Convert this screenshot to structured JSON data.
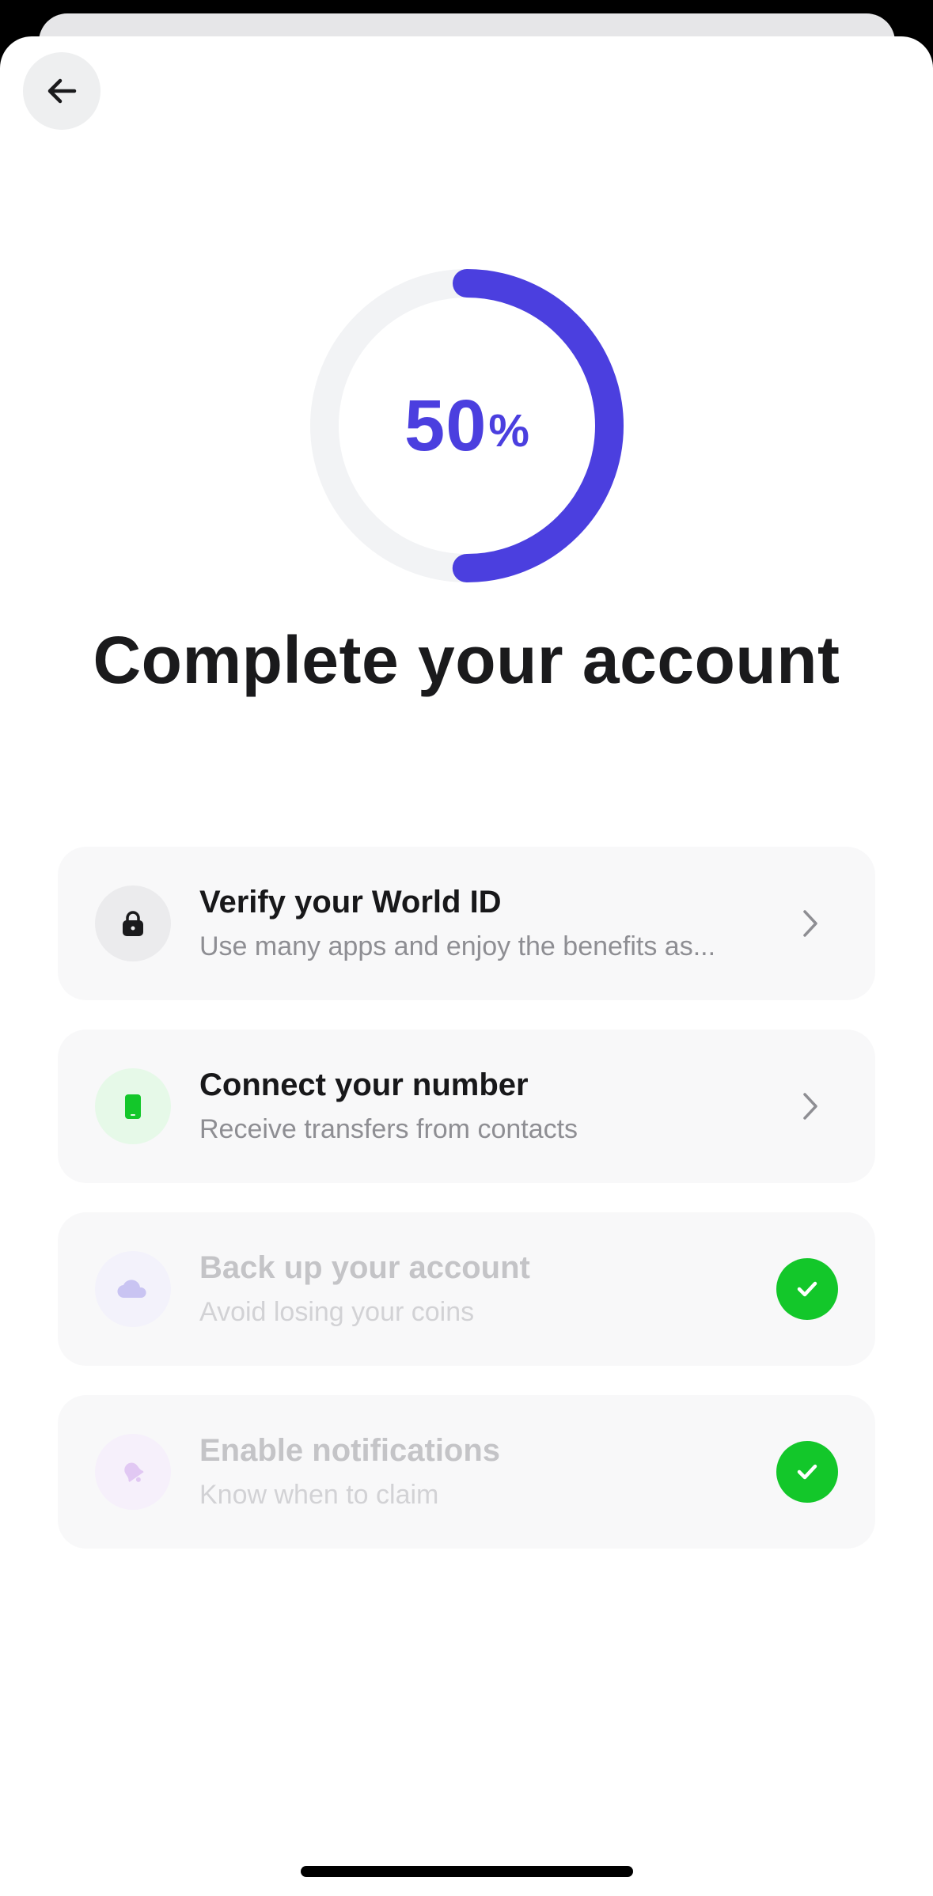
{
  "progress": {
    "value": 50,
    "number_text": "50",
    "unit_text": "%",
    "fraction": 0.5,
    "color": "#4b3fdf",
    "track_color": "#f2f3f5"
  },
  "header": {
    "back_icon": "arrow-left-icon"
  },
  "title": "Complete your account",
  "tasks": [
    {
      "title": "Verify your World ID",
      "subtitle": "Use many apps and enjoy the benefits as...",
      "icon": "lock-icon",
      "icon_bg": "#ebebed",
      "icon_color": "#1a1a1c",
      "status": "pending",
      "trailing_icon": "chevron-right-icon"
    },
    {
      "title": "Connect your number",
      "subtitle": "Receive transfers from contacts",
      "icon": "phone-icon",
      "icon_bg": "#e6f9e8",
      "icon_color": "#13c72a",
      "status": "pending",
      "trailing_icon": "chevron-right-icon"
    },
    {
      "title": "Back up your account",
      "subtitle": "Avoid losing your coins",
      "icon": "cloud-icon",
      "icon_bg": "#f3f2fb",
      "icon_color": "#c9c4f2",
      "status": "done",
      "trailing_icon": "check-icon"
    },
    {
      "title": "Enable notifications",
      "subtitle": "Know when to claim",
      "icon": "bell-icon",
      "icon_bg": "#f6f0fb",
      "icon_color": "#e1c8f3",
      "status": "done",
      "trailing_icon": "check-icon"
    }
  ],
  "colors": {
    "check_green": "#13c72a",
    "chevron": "#8e8e93"
  }
}
